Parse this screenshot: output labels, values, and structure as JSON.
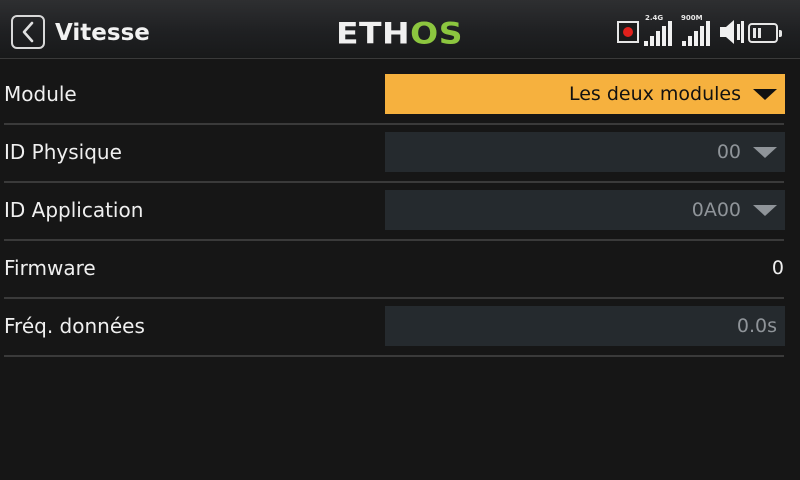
{
  "header": {
    "title": "Vitesse",
    "logo": {
      "part1": "ETH",
      "part2": "OS"
    },
    "signals": [
      {
        "label": "2.4G"
      },
      {
        "label": "900M"
      }
    ],
    "icons": [
      "back-icon",
      "record-icon",
      "signal-icon",
      "signal-icon",
      "speaker-icon",
      "battery-icon"
    ],
    "colors": {
      "logo_green": "#8cc63f",
      "record_red": "#e0201b"
    }
  },
  "settings": [
    {
      "label": "Module",
      "value": "Les deux modules",
      "kind": "dropdown",
      "active": true
    },
    {
      "label": "ID Physique",
      "value": "00",
      "kind": "dropdown",
      "active": false
    },
    {
      "label": "ID Application",
      "value": "0A00",
      "kind": "dropdown",
      "active": false
    },
    {
      "label": "Firmware",
      "value": "0",
      "kind": "text"
    },
    {
      "label": "Fréq. données",
      "value": "0.0s",
      "kind": "input",
      "active": false
    }
  ],
  "colors": {
    "accent": "#f6b13e",
    "field_bg": "#252a2e",
    "background": "#161616"
  }
}
